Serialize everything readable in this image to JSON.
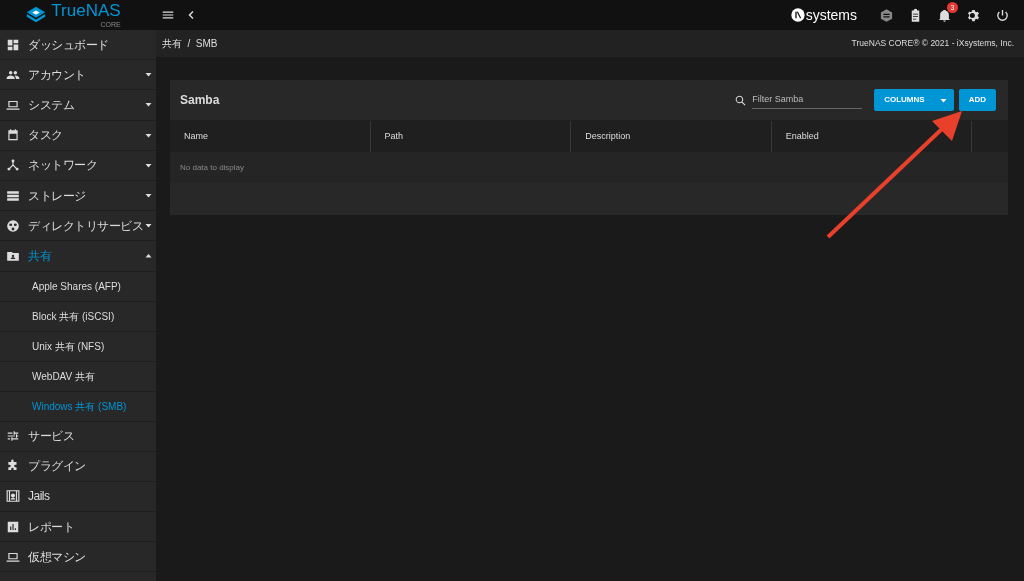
{
  "topbar": {
    "logo": "TrueNAS",
    "logo_sub": "CORE",
    "vendor": "systems",
    "notification_count": "3"
  },
  "sidebar": {
    "items": [
      {
        "kind": "link",
        "label": "ダッシュボード",
        "selected": false
      },
      {
        "kind": "group",
        "label": "アカウント",
        "selected": false,
        "expanded": false
      },
      {
        "kind": "group",
        "label": "システム",
        "selected": false,
        "expanded": false
      },
      {
        "kind": "group",
        "label": "タスク",
        "selected": false,
        "expanded": false
      },
      {
        "kind": "group",
        "label": "ネットワーク",
        "selected": false,
        "expanded": false
      },
      {
        "kind": "group",
        "label": "ストレージ",
        "selected": false,
        "expanded": false
      },
      {
        "kind": "group",
        "label": "ディレクトリサービス",
        "selected": false,
        "expanded": false
      },
      {
        "kind": "group",
        "label": "共有",
        "selected": true,
        "expanded": true,
        "children": [
          {
            "label": "Apple Shares (AFP)",
            "selected": false
          },
          {
            "label": "Block 共有 (iSCSI)",
            "selected": false
          },
          {
            "label": "Unix 共有 (NFS)",
            "selected": false
          },
          {
            "label": "WebDAV 共有",
            "selected": false
          },
          {
            "label": "Windows 共有 (SMB)",
            "selected": true
          }
        ]
      },
      {
        "kind": "link",
        "label": "サービス",
        "selected": false
      },
      {
        "kind": "link",
        "label": "プラグイン",
        "selected": false
      },
      {
        "kind": "link",
        "label": "Jails",
        "selected": false
      },
      {
        "kind": "link",
        "label": "レポート",
        "selected": false
      },
      {
        "kind": "link",
        "label": "仮想マシン",
        "selected": false
      }
    ]
  },
  "breadcrumb": {
    "items": [
      "共有",
      "SMB"
    ],
    "separator": "/"
  },
  "copyright": "TrueNAS CORE® © 2021 - iXsystems, Inc.",
  "card": {
    "title": "Samba",
    "filter": {
      "placeholder": "Filter Samba"
    },
    "buttons": [
      "COLUMNS",
      "ADD"
    ],
    "table": {
      "columns": [
        "Name",
        "Path",
        "Description",
        "Enabled"
      ],
      "empty_message": "No data to display"
    }
  }
}
